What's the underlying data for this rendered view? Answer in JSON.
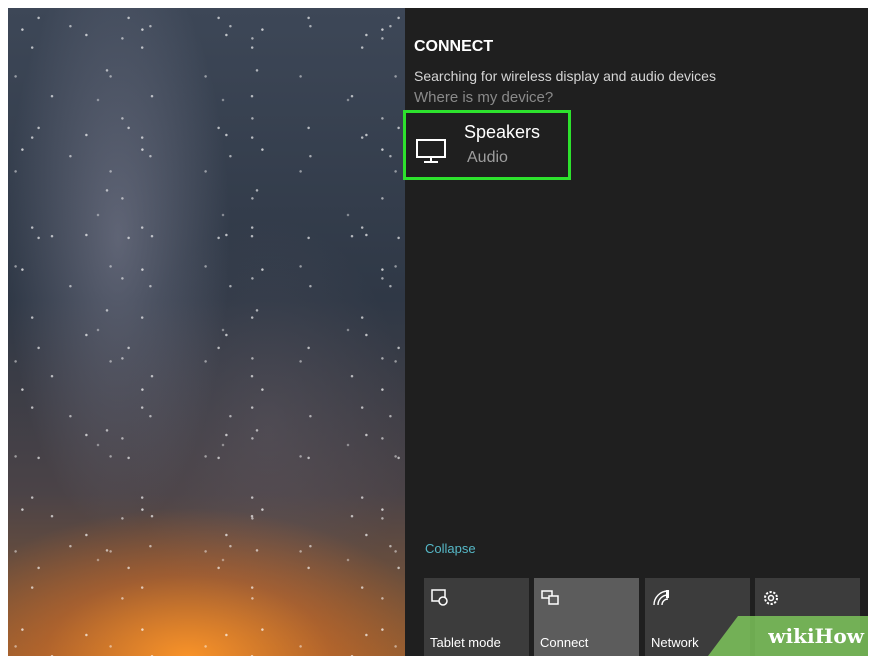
{
  "connect": {
    "title": "CONNECT",
    "status": "Searching for wireless display and audio devices",
    "help_link": "Where is my device?"
  },
  "devices": [
    {
      "name": "Speakers",
      "type": "Audio",
      "icon": "monitor-icon"
    }
  ],
  "action_center": {
    "collapse_label": "Collapse",
    "tiles": [
      {
        "label": "Tablet mode",
        "icon": "tablet-mode-icon",
        "active": false
      },
      {
        "label": "Connect",
        "icon": "connect-icon",
        "active": true
      },
      {
        "label": "Network",
        "icon": "network-icon",
        "active": false
      },
      {
        "label": "",
        "icon": "settings-icon",
        "active": false
      }
    ]
  },
  "watermark": {
    "text": "wikiHow"
  },
  "colors": {
    "highlight": "#2de12d",
    "panel_bg": "#1f1f1f",
    "accent_link": "#56b8c7"
  }
}
